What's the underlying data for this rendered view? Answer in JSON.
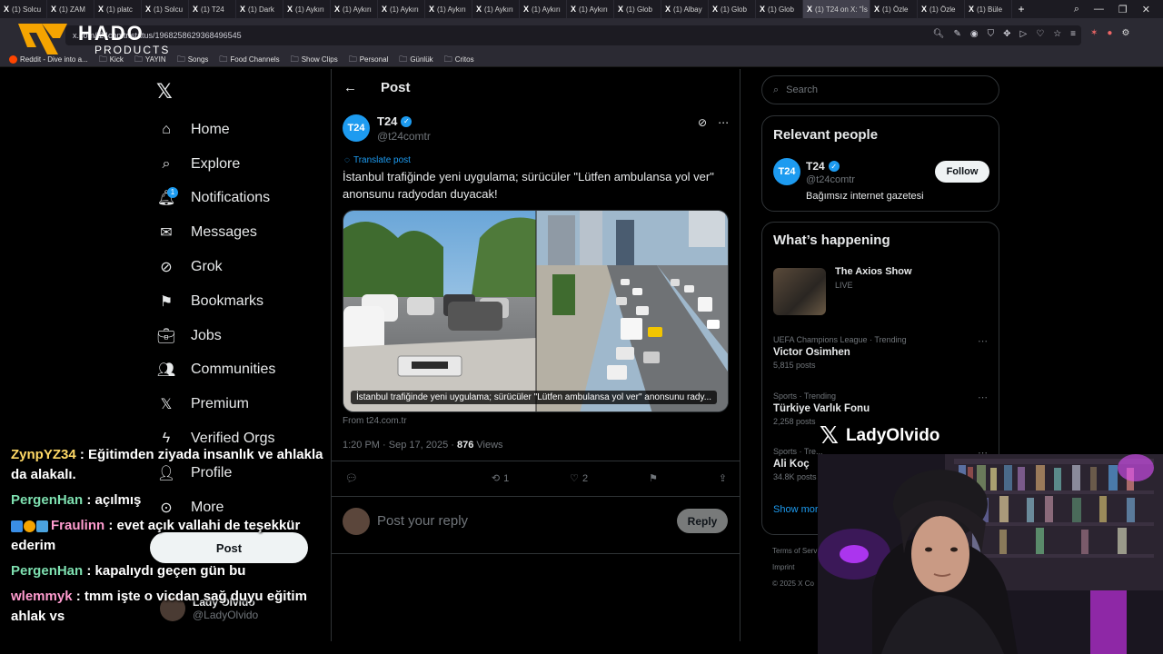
{
  "browser": {
    "tabs": [
      {
        "label": "(1) Solcu"
      },
      {
        "label": "(1) ZAM"
      },
      {
        "label": "(1) platc"
      },
      {
        "label": "(1) Solcu"
      },
      {
        "label": "(1) T24"
      },
      {
        "label": "(1) Dark"
      },
      {
        "label": "(1) Aykırı"
      },
      {
        "label": "(1) Aykırı"
      },
      {
        "label": "(1) Aykırı"
      },
      {
        "label": "(1) Aykırı"
      },
      {
        "label": "(1) Aykırı"
      },
      {
        "label": "(1) Aykırı"
      },
      {
        "label": "(1) Aykırı"
      },
      {
        "label": "(1) Glob"
      },
      {
        "label": "(1) Albay"
      },
      {
        "label": "(1) Glob"
      },
      {
        "label": "(1) Glob"
      },
      {
        "label": "(1) T24 on X: \"İs"
      },
      {
        "label": "(1) Özle"
      },
      {
        "label": "(1) Özle"
      },
      {
        "label": "(1) Büle"
      }
    ],
    "url": "x.com/t24comtr/status/1968258629368496545",
    "bookmarks": [
      "Reddit - Dive into a...",
      "Kick",
      "YAYIN",
      "Songs",
      "Food Channels",
      "Show Clips",
      "Personal",
      "Günlük",
      "Critos"
    ]
  },
  "overlay_logo": {
    "line1": "HADO",
    "line2": "PRODUCTS"
  },
  "nav": {
    "items": [
      {
        "label": "Home",
        "icon": "home-icon"
      },
      {
        "label": "Explore",
        "icon": "search-icon"
      },
      {
        "label": "Notifications",
        "icon": "bell-icon",
        "badge": "1"
      },
      {
        "label": "Messages",
        "icon": "mail-icon"
      },
      {
        "label": "Grok",
        "icon": "grok-icon"
      },
      {
        "label": "Bookmarks",
        "icon": "bookmark-icon"
      },
      {
        "label": "Jobs",
        "icon": "briefcase-icon"
      },
      {
        "label": "Communities",
        "icon": "people-icon"
      },
      {
        "label": "Premium",
        "icon": "x-icon"
      },
      {
        "label": "Verified Orgs",
        "icon": "lightning-icon"
      },
      {
        "label": "Profile",
        "icon": "person-icon"
      },
      {
        "label": "More",
        "icon": "more-circle-icon"
      }
    ],
    "post_label": "Post",
    "account_name": "Lady Olvido",
    "account_handle": "@LadyOlvido"
  },
  "post": {
    "header": "Post",
    "author_name": "T24",
    "author_handle": "@t24comtr",
    "avatar_text": "T24",
    "translate_label": "Translate post",
    "text": "İstanbul trafiğinde yeni uygulama; sürücüler \"Lütfen ambulansa yol ver\" anonsunu radyodan duyacak!",
    "media_caption": "İstanbul trafiğinde yeni uygulama; sürücüler \"Lütfen ambulansa yol ver\" anonsunu rady...",
    "source": "From t24.com.tr",
    "time": "1:20 PM · Sep 17, 2025 · ",
    "views_count": "876",
    "views_label": " Views",
    "retweets": "1",
    "likes": "2",
    "reply_placeholder": "Post your reply",
    "reply_button": "Reply"
  },
  "sidebar": {
    "search_placeholder": "Search",
    "relevant_title": "Relevant people",
    "person": {
      "name": "T24",
      "handle": "@t24comtr",
      "bio": "Bağımsız internet gazetesi",
      "follow_label": "Follow"
    },
    "happening_title": "What’s happening",
    "featured": {
      "title": "The Axios Show",
      "status": "LIVE"
    },
    "trends": [
      {
        "context": "UEFA Champions League · Trending",
        "title": "Victor Osimhen",
        "count": "5,815 posts"
      },
      {
        "context": "Sports · Trending",
        "title": "Türkiye Varlık Fonu",
        "count": "2,258 posts"
      },
      {
        "context": "Sports · Tre...",
        "title": "Ali Koç",
        "count": "34.8K posts"
      }
    ],
    "show_more": "Show more",
    "footer_line1": "Terms of Serv",
    "footer_line2": "Imprint",
    "footer_line3": "© 2025 X Co"
  },
  "chat": [
    {
      "user": "ZynpYZ34",
      "text": ": Eğitimden ziyada insanlık ve ahlakla da alakalı."
    },
    {
      "user": "PergenHan",
      "text": ": açılmış"
    },
    {
      "user": "Fraulinn",
      "text": ": evet açık vallahi de teşekkür ederim"
    },
    {
      "user": "PergenHan",
      "text": ": kapalıydı geçen gün bu"
    },
    {
      "user": "wlemmyk",
      "text": ": tmm işte o vicdan sağ duyu eğitim ahlak vs"
    }
  ],
  "streamer": {
    "name": "LadyOlvido"
  },
  "colors": {
    "accent": "#1d9bf0",
    "background": "#000000",
    "border": "#2f3336",
    "muted": "#71767b"
  }
}
